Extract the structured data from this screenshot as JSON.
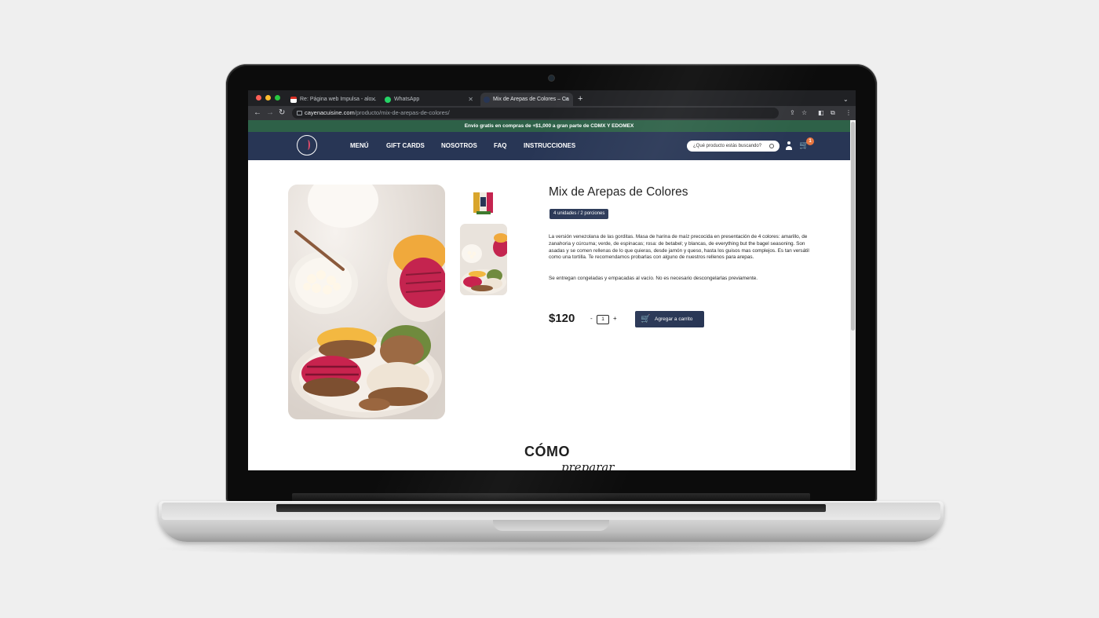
{
  "browser": {
    "tabs": [
      {
        "title": "Re: Página web Impulsa - alo...",
        "icon": "gmail-icon"
      },
      {
        "title": "WhatsApp",
        "icon": "whatsapp-icon"
      },
      {
        "title": "Mix de Arepas de Colores – Ca",
        "icon": "site-icon",
        "active": true
      }
    ],
    "url_domain": "cayenacuisine.com",
    "url_path": "/producto/mix-de-arepas-de-colores/"
  },
  "site": {
    "promo": "Envío gratis en compras de +$1,000 a gran parte de CDMX Y EDOMEX",
    "nav": [
      "MENÚ",
      "GIFT CARDS",
      "NOSOTROS",
      "FAQ",
      "INSTRUCCIONES"
    ],
    "search_placeholder": "¿Qué producto estás buscando?",
    "cart_count": "1",
    "accent_color": "#283655",
    "promo_color": "#2e6148"
  },
  "product": {
    "title": "Mix de Arepas de Colores",
    "badge": "4 unidades / 2 porciones",
    "description": "La versión venezolana de las gorditas. Masa de harina de maíz precocida en presentación de 4 colores: amarillo, de zanahoria y cúrcuma; verde, de espinacas; rosa: de betabel; y blancas, de everything but the bagel seasoning. Son asadas y se comen rellenas de lo que quieras, desde jamón y queso, hasta los guisos mas complejos. Es tan versátil como una tortilla. Te recomendamos probarlas con alguno de nuestros rellenos para arepas.",
    "note": "Se entregan congeladas y empacadas al vacío. No es necesario descongelarlas previamente.",
    "price": "$120",
    "quantity": "1",
    "qty_minus": "-",
    "qty_plus": "+",
    "add_to_cart": "Agregar a carrito"
  },
  "section": {
    "heading": "CÓMO",
    "subheading": "preparar"
  }
}
